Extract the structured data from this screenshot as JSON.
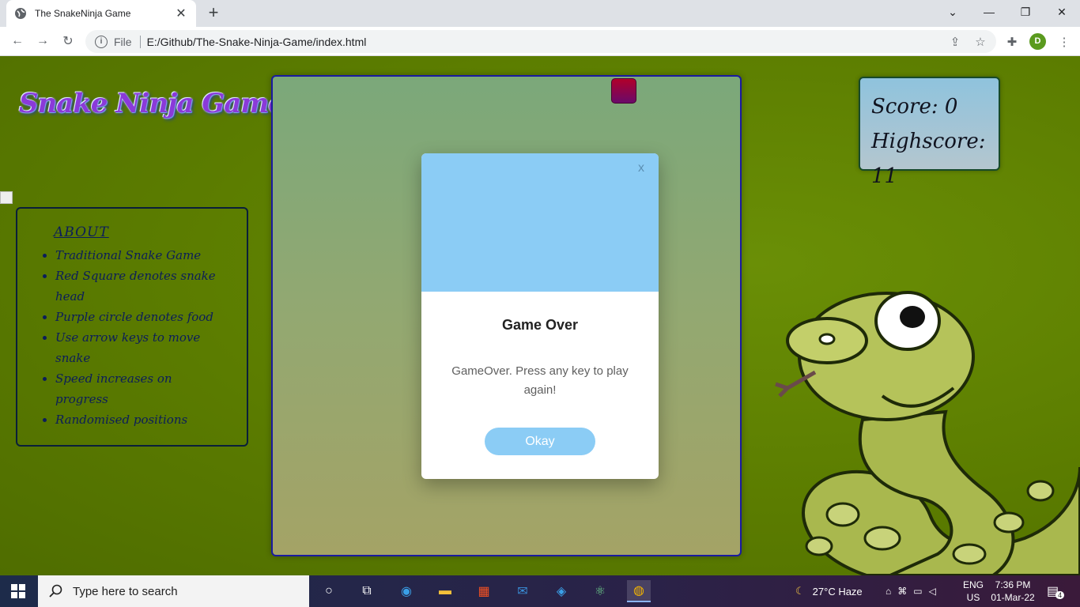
{
  "browser": {
    "tab_title": "The SnakeNinja Game",
    "tab_close": "✕",
    "new_tab": "+",
    "file_label": "File",
    "url": "E:/Github/The-Snake-Ninja-Game/index.html",
    "profile_initial": "D"
  },
  "page": {
    "logo_text": "Snake Ninja Game",
    "about": {
      "heading": "ABOUT",
      "items": [
        "Traditional Snake Game",
        "Red Square denotes snake head",
        "Purple circle denotes food",
        "Use arrow keys to move snake",
        "Speed increases on progress",
        "Randomised positions"
      ]
    },
    "score": {
      "score_label": "Score: 0",
      "highscore_label": "Highscore: 11"
    },
    "modal": {
      "close": "x",
      "title": "Game Over",
      "text": "GameOver. Press any key to play again!",
      "button": "Okay"
    }
  },
  "taskbar": {
    "search_placeholder": "Type here to search",
    "weather": "27°C  Haze",
    "lang_top": "ENG",
    "lang_bottom": "US",
    "time": "7:36 PM",
    "date": "01-Mar-22",
    "notification_count": "4"
  }
}
